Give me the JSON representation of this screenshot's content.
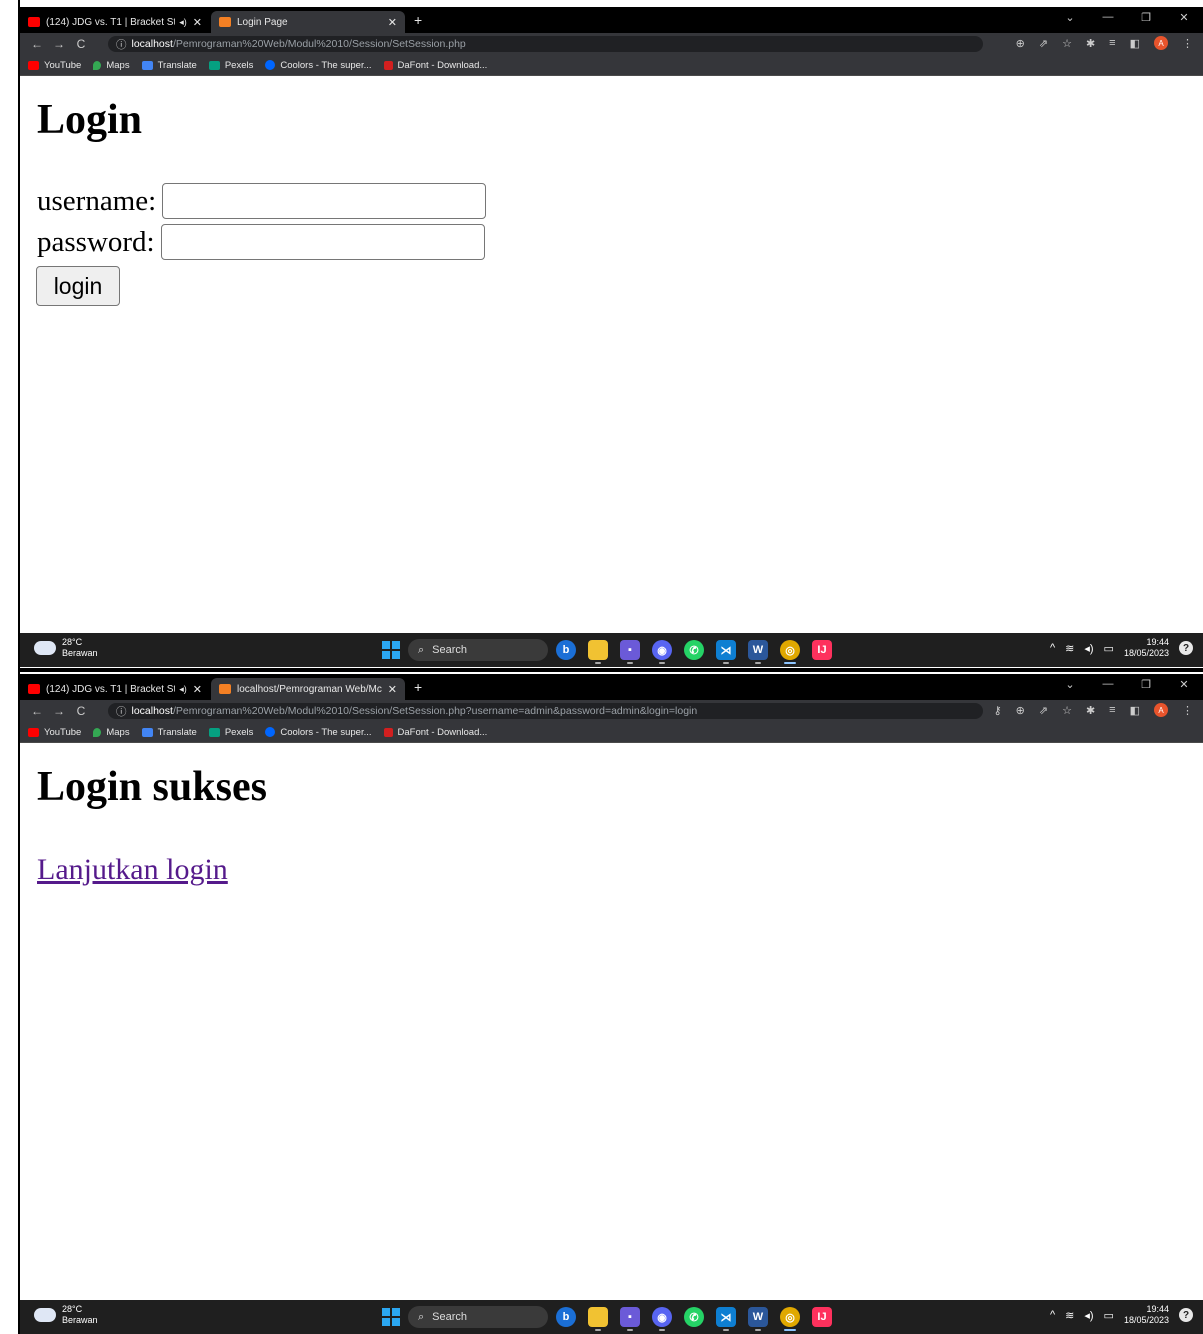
{
  "screen1": {
    "tabs": [
      {
        "label": "(124) JDG vs. T1 | Bracket Sta",
        "favicon_color": "#ff0000"
      },
      {
        "label": "Login Page",
        "favicon_color": "#f48024"
      }
    ],
    "url_host": "localhost",
    "url_path": "/Pemrograman%20Web/Modul%2010/Session/SetSession.php",
    "heading": "Login",
    "username_label": "username:",
    "password_label": "password:",
    "login_button": "login"
  },
  "screen2": {
    "tabs": [
      {
        "label": "(124) JDG vs. T1 | Bracket Sta",
        "favicon_color": "#ff0000"
      },
      {
        "label": "localhost/Pemrograman Web/Mc",
        "favicon_color": "#f48024"
      }
    ],
    "url_host": "localhost",
    "url_path": "/Pemrograman%20Web/Modul%2010/Session/SetSession.php?username=admin&password=admin&login=login",
    "heading": "Login sukses",
    "link": "Lanjutkan login"
  },
  "bookmarks": [
    {
      "label": "YouTube",
      "color": "#ff0000"
    },
    {
      "label": "Maps",
      "color": "#34a853"
    },
    {
      "label": "Translate",
      "color": "#4285f4"
    },
    {
      "label": "Pexels",
      "color": "#05a081"
    },
    {
      "label": "Coolors - The super...",
      "color": "#0066ff"
    },
    {
      "label": "DaFont - Download...",
      "color": "#d21f1f"
    }
  ],
  "taskbar": {
    "temperature": "28°C",
    "weather": "Berawan",
    "search": "Search",
    "time": "19:44",
    "date": "18/05/2023"
  },
  "colors": {
    "link_visited": "#551a8b",
    "chrome_dark": "#35363a"
  }
}
